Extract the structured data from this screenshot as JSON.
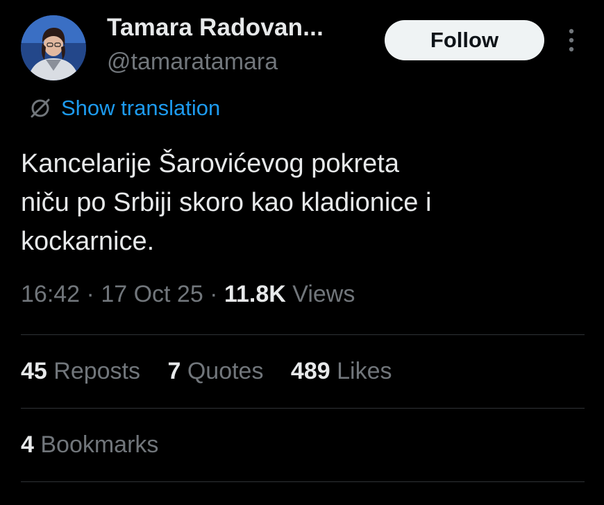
{
  "author": {
    "display_name": "Tamara Radovan...",
    "handle": "@tamaratamara"
  },
  "actions": {
    "follow_label": "Follow",
    "more_icon": "more-vertical-icon"
  },
  "translation": {
    "icon": "globe-strike-icon",
    "label": "Show translation"
  },
  "tweet": {
    "lines": [
      "Kancelarije Šarovićevog pokreta",
      "niču po Srbiji skoro kao kladionice i",
      "kockarnice."
    ]
  },
  "meta": {
    "time": "16:42",
    "separator": " · ",
    "date": "17 Oct 25",
    "views_count": "11.8K",
    "views_label": " Views"
  },
  "stats": [
    {
      "count": "45",
      "label": " Reposts"
    },
    {
      "count": "7",
      "label": " Quotes"
    },
    {
      "count": "489",
      "label": " Likes"
    }
  ],
  "bookmarks": {
    "count": "4",
    "label": " Bookmarks"
  },
  "colors": {
    "background": "#000000",
    "primary_text": "#e7e9ea",
    "secondary_text": "#71767b",
    "link": "#1d9bf0",
    "divider": "#2f3336",
    "follow_bg": "#eff3f4"
  }
}
